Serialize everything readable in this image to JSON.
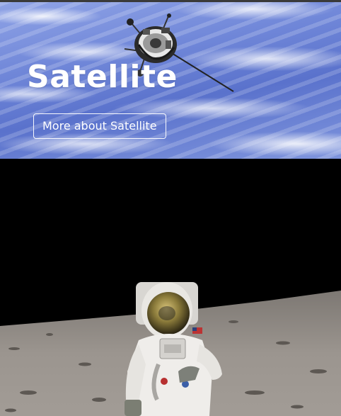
{
  "hero": {
    "title": "Satellite",
    "button_label": "More about Satellite",
    "image_subject": "satellite-over-earth",
    "colors": {
      "sky": "#6f86d8",
      "text": "#ffffff"
    }
  },
  "moon_section": {
    "image_subject": "astronaut-on-moon",
    "colors": {
      "space": "#000000",
      "surface": "#9a958f"
    }
  }
}
